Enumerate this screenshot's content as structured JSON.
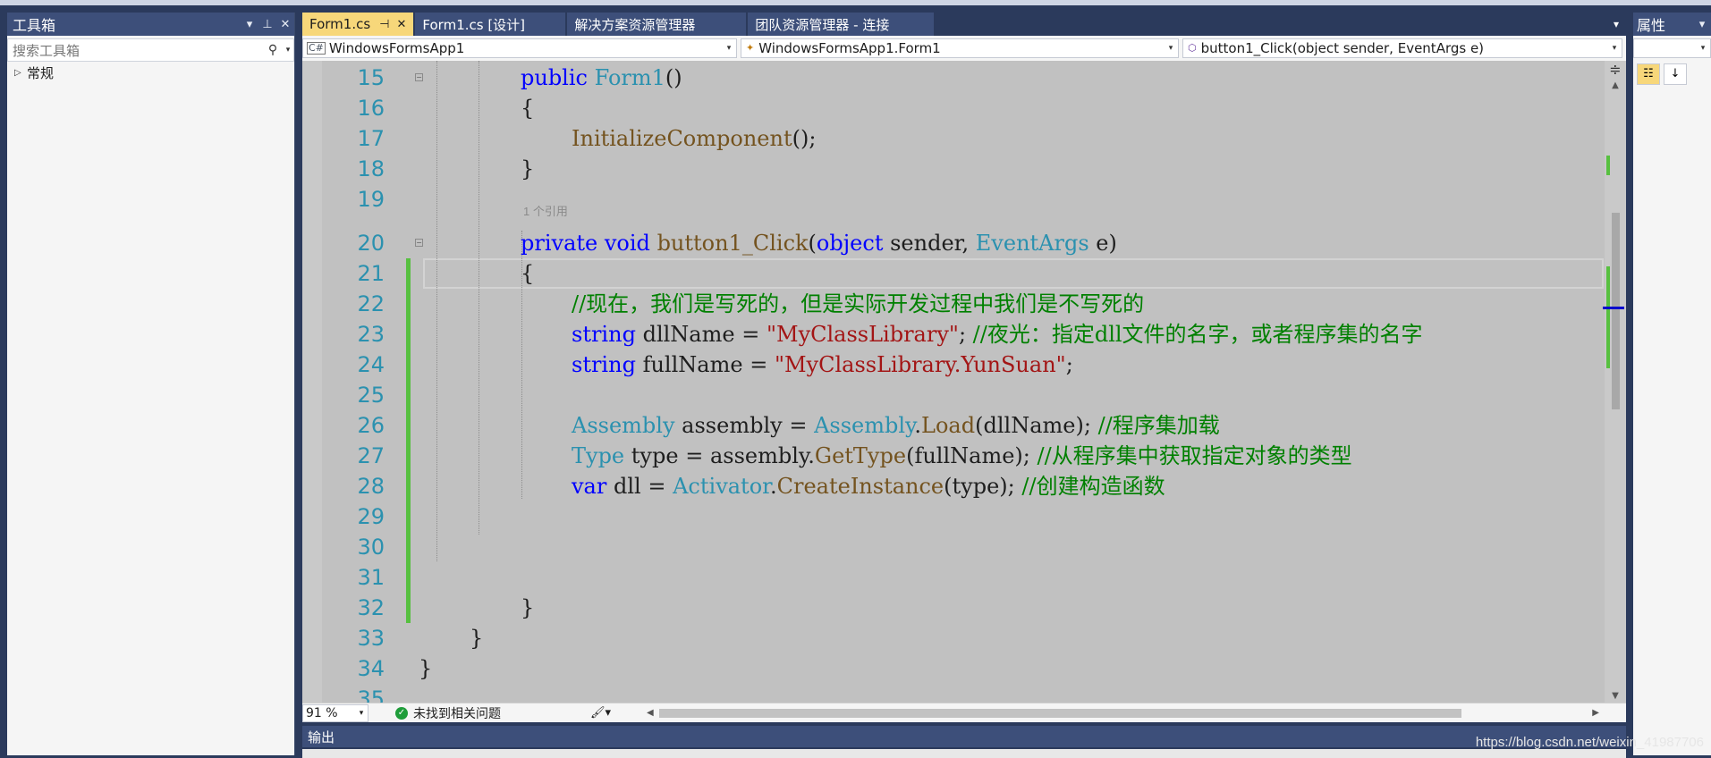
{
  "toolbox": {
    "title": "工具箱",
    "search_placeholder": "搜索工具箱",
    "group": "常规"
  },
  "tabs": [
    {
      "label": "Form1.cs",
      "active": true
    },
    {
      "label": "Form1.cs [设计]"
    },
    {
      "label": "解决方案资源管理器"
    },
    {
      "label": "团队资源管理器 - 连接"
    }
  ],
  "nav": {
    "project": "WindowsFormsApp1",
    "class": "WindowsFormsApp1.Form1",
    "member": "button1_Click(object sender, EventArgs e)"
  },
  "editor": {
    "codelens": "1 个引用",
    "lines": [
      {
        "n": "15",
        "code": "public Form1()"
      },
      {
        "n": "16",
        "code": "{"
      },
      {
        "n": "17",
        "code": "InitializeComponent();"
      },
      {
        "n": "18",
        "code": "}"
      },
      {
        "n": "19",
        "code": ""
      },
      {
        "n": "20",
        "code": "private void button1_Click(object sender, EventArgs e)"
      },
      {
        "n": "21",
        "code": "{"
      },
      {
        "n": "22",
        "code": "//现在，我们是写死的，但是实际开发过程中我们是不写死的"
      },
      {
        "n": "23",
        "code": "string dllName = \"MyClassLibrary\"; //夜光：指定dll文件的名字，或者程序集的名字"
      },
      {
        "n": "24",
        "code": "string fullName = \"MyClassLibrary.YunSuan\";"
      },
      {
        "n": "25",
        "code": ""
      },
      {
        "n": "26",
        "code": "Assembly assembly = Assembly.Load(dllName); //程序集加载"
      },
      {
        "n": "27",
        "code": "Type type = assembly.GetType(fullName); //从程序集中获取指定对象的类型"
      },
      {
        "n": "28",
        "code": "var dll = Activator.CreateInstance(type); //创建构造函数"
      },
      {
        "n": "29",
        "code": ""
      },
      {
        "n": "30",
        "code": ""
      },
      {
        "n": "31",
        "code": ""
      },
      {
        "n": "32",
        "code": "}"
      },
      {
        "n": "33",
        "code": "}"
      },
      {
        "n": "34",
        "code": "}"
      },
      {
        "n": "35",
        "code": ""
      }
    ]
  },
  "status": {
    "zoom": "91 %",
    "issues": "未找到相关问题"
  },
  "output": {
    "title": "输出"
  },
  "properties": {
    "title": "属性"
  },
  "watermark": "https://blog.csdn.net/weixin_41987706"
}
